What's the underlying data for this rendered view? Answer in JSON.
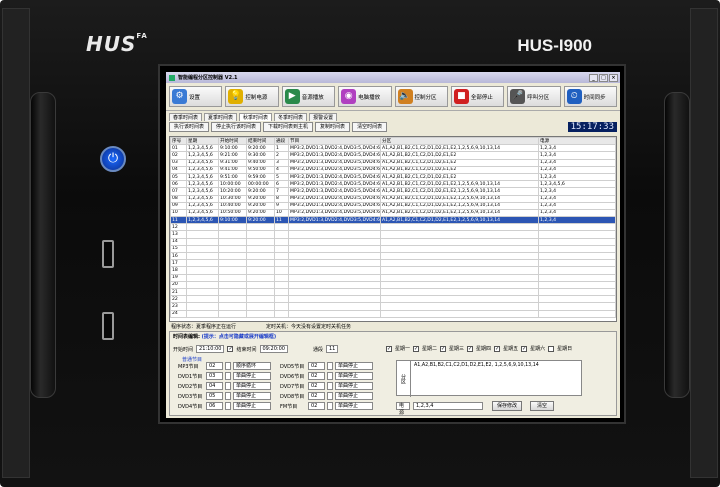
{
  "device": {
    "brand": "HUS",
    "brand_suffix": "FA",
    "model": "HUS-I900"
  },
  "app": {
    "title": "智能编程分区控制器 V2.1",
    "toolbar": [
      {
        "label": "设置",
        "icon": "gear-icon",
        "color": "#3a7bd5",
        "glyph": "⚙"
      },
      {
        "label": "控制电源",
        "icon": "bulb-icon",
        "color": "#e0b000",
        "glyph": "💡"
      },
      {
        "label": "音源播放",
        "icon": "player-icon",
        "color": "#2a8a4a",
        "glyph": "▶"
      },
      {
        "label": "电脑播放",
        "icon": "cd-icon",
        "color": "#b040c0",
        "glyph": "◉"
      },
      {
        "label": "控制分区",
        "icon": "speaker-icon",
        "color": "#d08020",
        "glyph": "🔈"
      },
      {
        "label": "全部停止",
        "icon": "stop-icon",
        "color": "#d02020",
        "glyph": "■"
      },
      {
        "label": "呼叫分区",
        "icon": "microphone-icon",
        "color": "#555555",
        "glyph": "🎤"
      },
      {
        "label": "时间同步",
        "icon": "clock-icon",
        "color": "#2060c0",
        "glyph": "⏲"
      }
    ],
    "tabs": [
      "春季时间表",
      "夏季时间表",
      "秋季时间表",
      "冬季时间表",
      "报警设置"
    ],
    "commands": [
      "执行该时间表",
      "停止执行该时间表",
      "下载时间表到主机",
      "复制时间表",
      "清空时间表"
    ],
    "clock": "15:17:33",
    "grid": {
      "headers": [
        "序号",
        "星期",
        "开始时间",
        "结束时间",
        "通段",
        "节目",
        "分区",
        "电源"
      ],
      "rows": [
        [
          "01",
          "1,2,3,4,5,6",
          "9:10:00",
          "9:20:00",
          "1",
          "MP3:2,DVD1:3,DVD2:4,DVD3:5,DVD4:6,",
          "A1,A2,B1,B2,C1,C2,D1,D2,E1,E2,1,2,5,6,9,10,13,14",
          "1,2,3,4"
        ],
        [
          "02",
          "1,2,3,4,5,6",
          "9:21:00",
          "9:30:00",
          "2",
          "MP3:2,DVD1:3,DVD2:4,DVD3:5,DVD4:6,",
          "A1,A2,B1,B2,C1,C2,D1,D2,E1,E2",
          "1,2,3,4"
        ],
        [
          "03",
          "1,2,3,4,5,6",
          "9:31:00",
          "9:40:00",
          "3",
          "MP3:2,DVD1:3,DVD2:4,DVD3:5,DVD4:6,",
          "A1,A2,B1,B2,C1,C2,D1,D2,E1,E2",
          "1,2,3,4"
        ],
        [
          "04",
          "1,2,3,4,5,6",
          "9:41:00",
          "9:50:00",
          "4",
          "MP3:2,DVD1:3,DVD2:4,DVD3:5,DVD4:6,",
          "A1,A2,B1,B2,C1,C2,D1,D2,E1,E2",
          "1,2,3,4"
        ],
        [
          "05",
          "1,2,3,4,5,6",
          "9:51:00",
          "9:59:00",
          "5",
          "MP3:2,DVD1:3,DVD2:4,DVD3:5,DVD4:6,",
          "A1,A2,B1,B2,C1,C2,D1,D2,E1,E2",
          "1,2,3,4"
        ],
        [
          "06",
          "1,2,3,4,5,6",
          "10:00:00",
          "00:00:00",
          "6",
          "MP3:2,DVD1:3,DVD2:4,DVD3:5,DVD4:6,",
          "A1,A2,B1,B2,C1,C2,D1,D2,E1,E2,1,2,5,6,9,10,13,14",
          "1,2,3,4,5,6"
        ],
        [
          "07",
          "1,2,3,4,5,6",
          "10:20:00",
          "9:20:00",
          "7",
          "MP3:2,DVD1:3,DVD2:4,DVD3:5,DVD4:6,",
          "A1,A2,B1,B2,C1,C2,D1,D2,E1,E2,1,2,5,6,9,10,13,14",
          "1,2,3,4"
        ],
        [
          "08",
          "1,2,3,4,5,6",
          "10:30:00",
          "9:20:00",
          "8",
          "MP3:2,DVD1:3,DVD2:4,DVD3:5,DVD4:6,",
          "A1,A2,B1,B2,C1,C2,D1,D2,E1,E2,1,2,5,6,9,10,13,14",
          "1,2,3,4"
        ],
        [
          "09",
          "1,2,3,4,5,6",
          "10:40:00",
          "9:20:00",
          "9",
          "MP3:2,DVD1:3,DVD2:4,DVD3:5,DVD4:6,",
          "A1,A2,B1,B2,C1,C2,D1,D2,E1,E2,1,2,5,6,9,10,13,14",
          "1,2,3,4"
        ],
        [
          "10",
          "1,2,3,4,5,6",
          "10:50:00",
          "9:20:00",
          "10",
          "MP3:2,DVD1:3,DVD2:4,DVD3:5,DVD4:6,",
          "A1,A2,B1,B2,C1,C2,D1,D2,E1,E2,1,2,5,6,9,10,13,14",
          "1,2,3,4"
        ],
        [
          "11",
          "1,2,3,4,5,6",
          "9:10:00",
          "9:20:00",
          "11",
          "MP3:2,DVD1:3,DVD2:4,DVD3:5,DVD4:6,",
          "A1,A2,B1,B2,C1,C2,D1,D2,E1,E2,1,2,5,6,9,10,13,14",
          "1,2,3,4"
        ],
        [
          "12",
          "",
          "",
          "",
          "",
          "",
          "",
          ""
        ],
        [
          "13",
          "",
          "",
          "",
          "",
          "",
          "",
          ""
        ],
        [
          "14",
          "",
          "",
          "",
          "",
          "",
          "",
          ""
        ],
        [
          "15",
          "",
          "",
          "",
          "",
          "",
          "",
          ""
        ],
        [
          "16",
          "",
          "",
          "",
          "",
          "",
          "",
          ""
        ],
        [
          "17",
          "",
          "",
          "",
          "",
          "",
          "",
          ""
        ],
        [
          "18",
          "",
          "",
          "",
          "",
          "",
          "",
          ""
        ],
        [
          "19",
          "",
          "",
          "",
          "",
          "",
          "",
          ""
        ],
        [
          "20",
          "",
          "",
          "",
          "",
          "",
          "",
          ""
        ],
        [
          "21",
          "",
          "",
          "",
          "",
          "",
          "",
          ""
        ],
        [
          "22",
          "",
          "",
          "",
          "",
          "",
          "",
          ""
        ],
        [
          "23",
          "",
          "",
          "",
          "",
          "",
          "",
          ""
        ],
        [
          "24",
          "",
          "",
          "",
          "",
          "",
          "",
          ""
        ]
      ],
      "selected_row": 10
    },
    "status": {
      "state_label": "程序状态：",
      "state_value": "夏季程序正在运行",
      "timer_label": "定时关机：",
      "timer_value": "今天没有设置定时关机任务"
    },
    "editor": {
      "title": "时间表编辑:",
      "hint": "(提示：点击可隐藏或展开编辑框)",
      "start_label": "开始时间",
      "start_value": "21:10:00",
      "end_label": "结束时间",
      "end_value": "09:20:00",
      "channel_label": "通段",
      "channel_value": "11",
      "weekdays": [
        "星期一",
        "星期二",
        "星期三",
        "星期四",
        "星期五",
        "星期六",
        "星期日"
      ],
      "weekdays_checked": [
        true,
        true,
        true,
        true,
        true,
        true,
        false
      ],
      "programs_label": "普通节目",
      "programs_left": [
        {
          "name": "MP3节目",
          "num": "02",
          "mode": "顺序循环"
        },
        {
          "name": "DVD1节目",
          "num": "03",
          "mode": "单曲停止"
        },
        {
          "name": "DVD2节目",
          "num": "04",
          "mode": "单曲停止"
        },
        {
          "name": "DVD3节目",
          "num": "05",
          "mode": "单曲停止"
        },
        {
          "name": "DVD4节目",
          "num": "06",
          "mode": "单曲停止"
        }
      ],
      "programs_right": [
        {
          "name": "DVD5节目",
          "num": "02",
          "mode": "单曲停止"
        },
        {
          "name": "DVD6节目",
          "num": "02",
          "mode": "单曲停止"
        },
        {
          "name": "DVD7节目",
          "num": "02",
          "mode": "单曲停止"
        },
        {
          "name": "DVD8节目",
          "num": "02",
          "mode": "单曲停止"
        },
        {
          "name": "FM节目",
          "num": "02",
          "mode": "单曲停止"
        }
      ],
      "zone_label": "分区",
      "zone_value": "A1,A2,B1,B2,C1,C2,D1,D2,E1,E2, 1,2,5,6,9,10,13,14",
      "power_label": "电源",
      "power_value": "1,2,3,4",
      "save_label": "保存修改",
      "clear_label": "清空"
    }
  }
}
